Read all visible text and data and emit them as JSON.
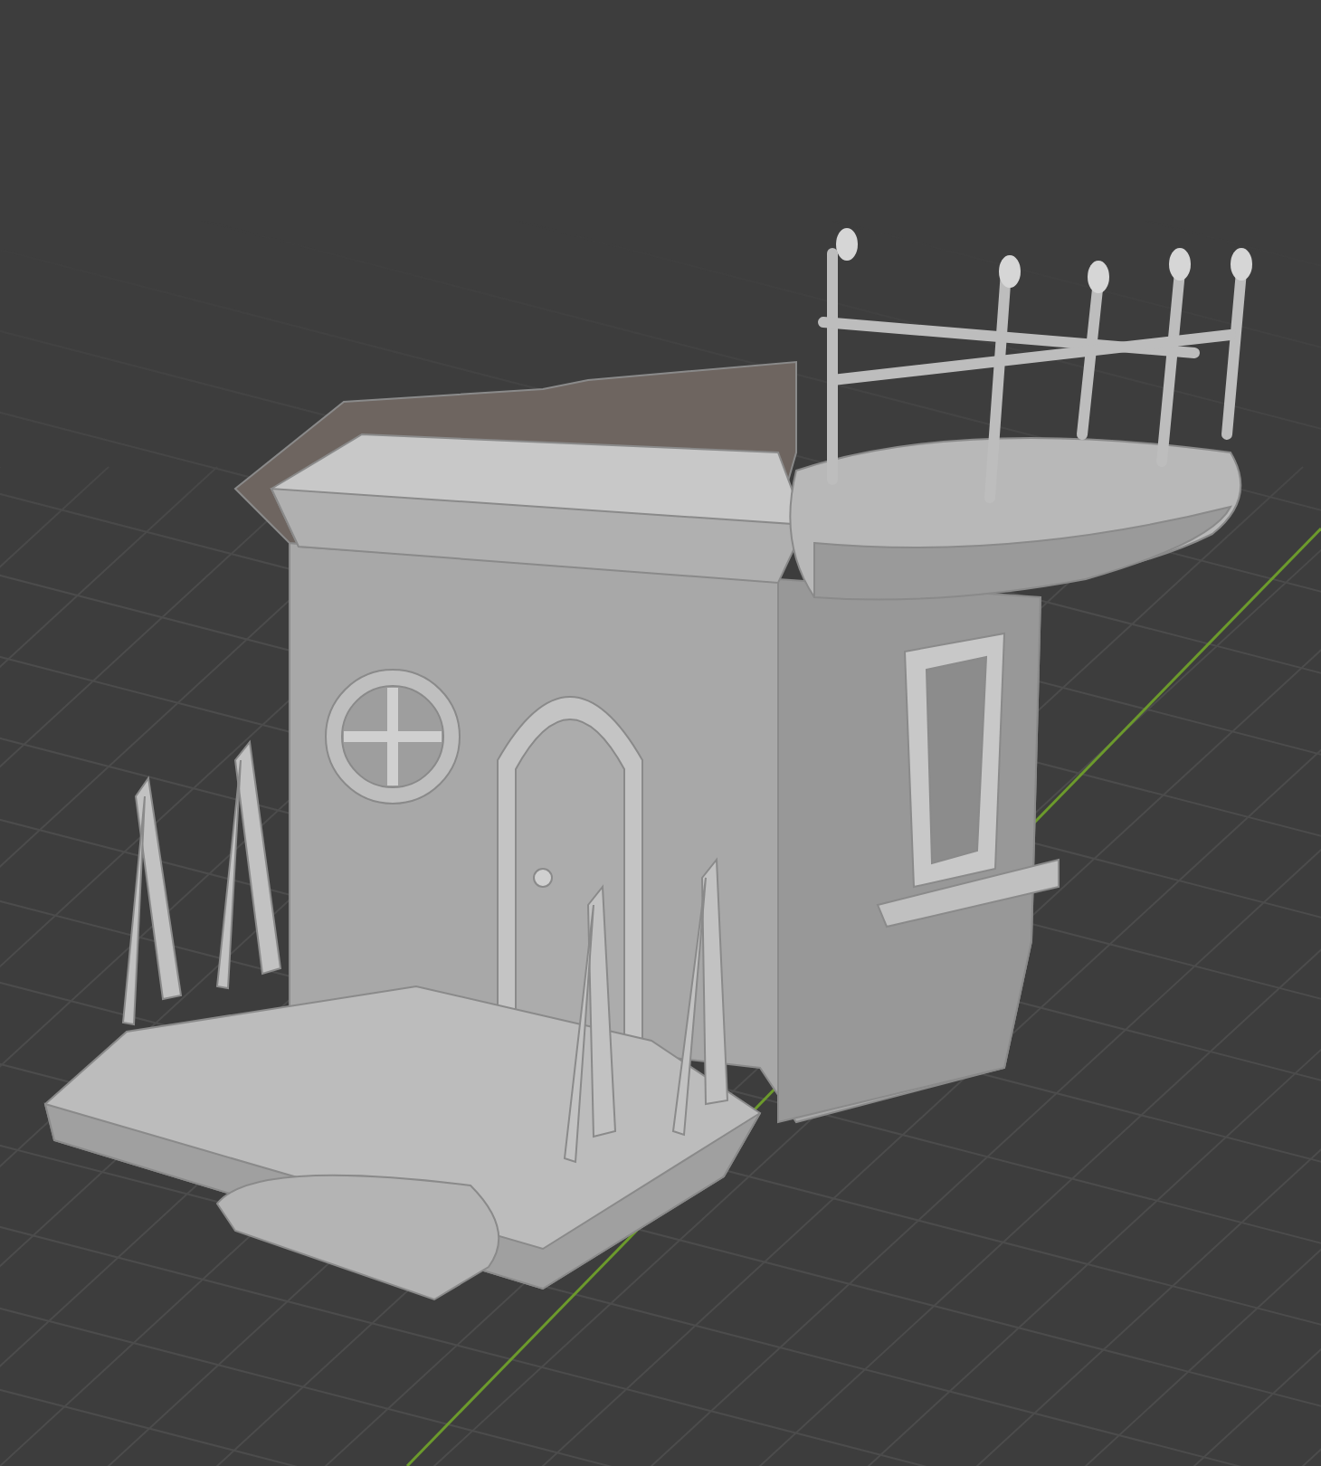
{
  "viewport": {
    "grid": true,
    "y_axis": true
  }
}
